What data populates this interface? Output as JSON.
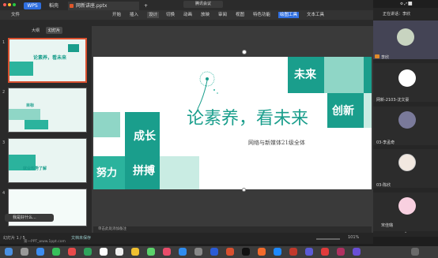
{
  "tabbar": {
    "wps_label": "WPS",
    "tab_home": "稻壳",
    "tab_file": "网新讲座.pptx"
  },
  "meeting": {
    "title": "腾讯会议"
  },
  "menu": [
    "文件",
    "开始",
    "插入",
    "设计",
    "切换",
    "动画",
    "放映",
    "审阅",
    "视图",
    "特色功能",
    "绘图工具",
    "文本工具"
  ],
  "thumbs": {
    "tabs": [
      "大纲",
      "幻灯片"
    ],
    "items": [
      {
        "num": "1",
        "caption": "论素养，看未来"
      },
      {
        "num": "2",
        "caption": "目标"
      },
      {
        "num": "3",
        "caption": "就业形势了解"
      },
      {
        "num": "4",
        "caption": ""
      }
    ],
    "tooltip": "我是好什么..."
  },
  "slide": {
    "title": "论素养，看未来",
    "subtitle": "网络与新媒体21级全体",
    "words": {
      "weilai": "未来",
      "chuangxin": "创新",
      "chengzhang": "成长",
      "nuli": "努力",
      "pinbo": "拼搏"
    }
  },
  "notes": "单击此处添加备注",
  "status": {
    "slide_info": "幻灯片 1 / 5",
    "theme": "第一PPT_www.1ppt.com",
    "lang": "文档未保存",
    "zoom": "101%"
  },
  "participants": {
    "header": "正在讲话：李欣",
    "list": [
      {
        "name": "李欣",
        "color": "#c8d4c0"
      },
      {
        "name": "网新-2103-沈文豪",
        "color": "#ffffff"
      },
      {
        "name": "03-李孟奇",
        "color": "#7a7a9a"
      },
      {
        "name": "03-陈欣",
        "color": "#f2e8e0"
      },
      {
        "name": "宋佳璐",
        "color": "#f8d0e0"
      }
    ]
  },
  "colors": {
    "teal_dark": "#1a9e8c",
    "teal": "#2bb39d",
    "teal_light": "#8fd6c6",
    "teal_pale": "#c9ece3"
  }
}
